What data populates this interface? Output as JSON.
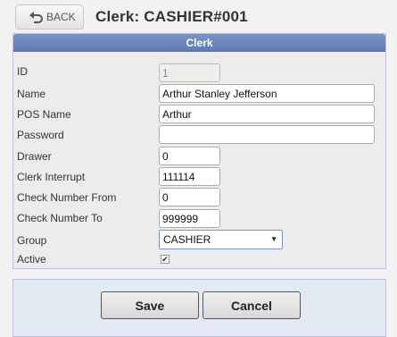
{
  "header": {
    "back_label": "BACK",
    "title": "Clerk: CASHIER#001"
  },
  "panel": {
    "title": "Clerk"
  },
  "form": {
    "id": {
      "label": "ID",
      "value": "1"
    },
    "name": {
      "label": "Name",
      "value": "Arthur Stanley Jefferson"
    },
    "pos_name": {
      "label": "POS Name",
      "value": "Arthur"
    },
    "password": {
      "label": "Password",
      "value": ""
    },
    "drawer": {
      "label": "Drawer",
      "value": "0"
    },
    "clerk_interrupt": {
      "label": "Clerk Interrupt",
      "value": "111114"
    },
    "check_from": {
      "label": "Check Number From",
      "value": "0"
    },
    "check_to": {
      "label": "Check Number To",
      "value": "999999"
    },
    "group": {
      "label": "Group",
      "value": "CASHIER"
    },
    "active": {
      "label": "Active",
      "checked": true
    }
  },
  "actions": {
    "save_label": "Save",
    "cancel_label": "Cancel"
  },
  "colors": {
    "header_blue": "#6a84bd",
    "panel_bg": "#ececec",
    "bottom_bg": "#e3e9f2"
  }
}
